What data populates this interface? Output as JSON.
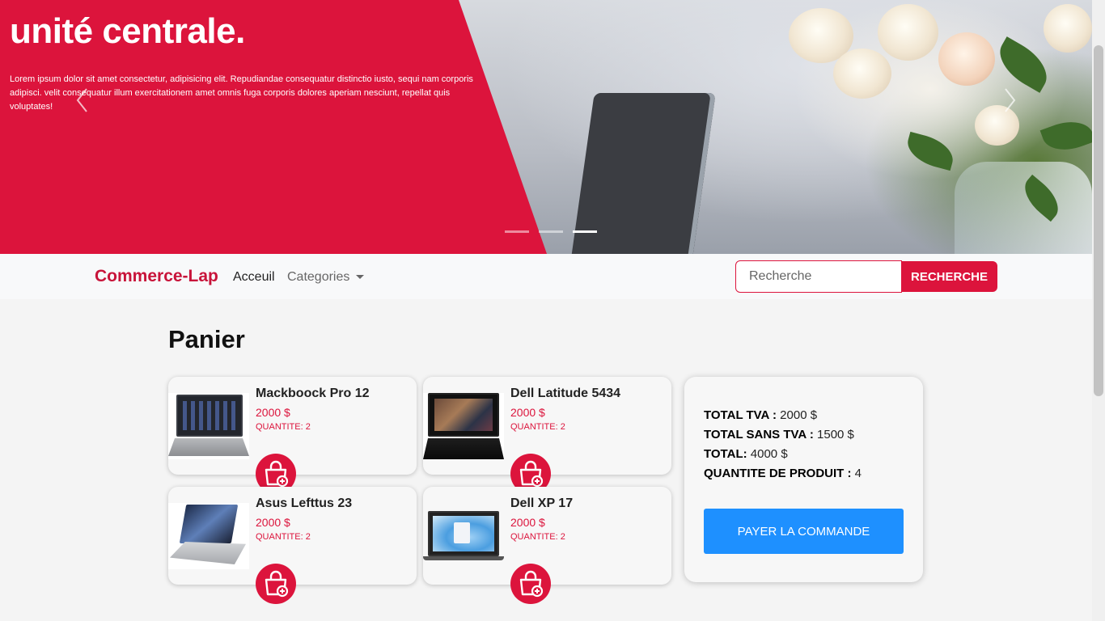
{
  "hero": {
    "title": "unité centrale.",
    "text": "Lorem ipsum dolor sit amet consectetur, adipisicing elit. Repudiandae consequatur distinctio iusto, sequi nam corporis adipisci. velit consequatur illum exercitationem amet omnis fuga corporis dolores aperiam nesciunt, repellat quis voluptates!",
    "prev_icon": "chevron-left-icon",
    "next_icon": "chevron-right-icon",
    "slides": 3,
    "active_slide": 3,
    "accent_color": "#dc143c"
  },
  "navbar": {
    "brand": "Commerce-Lap",
    "links": [
      {
        "label": "Acceuil"
      },
      {
        "label": "Categories"
      }
    ],
    "search": {
      "placeholder": "Recherche",
      "value": "",
      "button_label": "RECHERCHE"
    }
  },
  "panier": {
    "title": "Panier",
    "items": [
      {
        "name": "Mackboock Pro 12",
        "price": "2000 $",
        "quantity": "QUANTITE: 2",
        "icon": "cart-plus-icon"
      },
      {
        "name": "Dell Latitude 5434",
        "price": "2000 $",
        "quantity": "QUANTITE: 2",
        "icon": "cart-plus-icon"
      },
      {
        "name": "Asus Lefttus 23",
        "price": "2000 $",
        "quantity": "QUANTITE: 2",
        "icon": "cart-plus-icon"
      },
      {
        "name": "Dell XP 17",
        "price": "2000 $",
        "quantity": "QUANTITE: 2",
        "icon": "cart-plus-icon"
      }
    ],
    "summary": {
      "tva_label": "TOTAL TVA :",
      "tva_value": " 2000 $",
      "sans_tva_label": "TOTAL SANS TVA :",
      "sans_tva_value": " 1500 $",
      "total_label": "TOTAL:",
      "total_value": " 4000 $",
      "qty_label": "QUANTITE DE PRODUIT :",
      "qty_value": " 4",
      "pay_label": "PAYER LA COMMANDE",
      "pay_color": "#1e90ff"
    }
  }
}
